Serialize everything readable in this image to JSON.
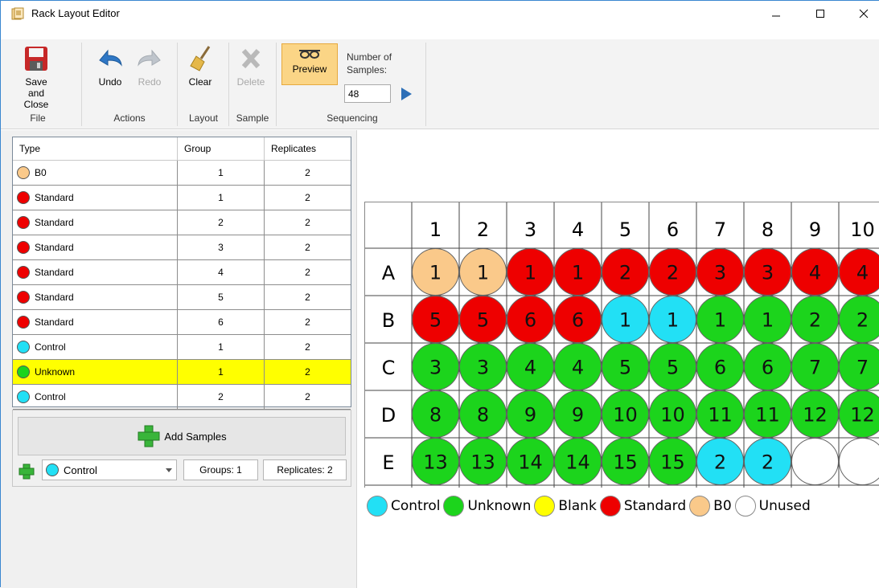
{
  "window": {
    "title": "Rack Layout Editor"
  },
  "ribbon": {
    "save_close": "Save and\nClose",
    "undo": "Undo",
    "redo": "Redo",
    "clear": "Clear",
    "delete": "Delete",
    "preview": "Preview",
    "number_of_samples_label": "Number of\nSamples:",
    "number_of_samples_value": "48",
    "groups": {
      "file": "File",
      "actions": "Actions",
      "layout": "Layout",
      "sample": "Sample",
      "sequencing": "Sequencing"
    }
  },
  "table": {
    "headers": {
      "type": "Type",
      "group": "Group",
      "replicates": "Replicates"
    },
    "rows": [
      {
        "type": "B0",
        "group": "1",
        "replicates": "2",
        "color": "#fac98a",
        "selected": false
      },
      {
        "type": "Standard",
        "group": "1",
        "replicates": "2",
        "color": "#ee0000",
        "selected": false
      },
      {
        "type": "Standard",
        "group": "2",
        "replicates": "2",
        "color": "#ee0000",
        "selected": false
      },
      {
        "type": "Standard",
        "group": "3",
        "replicates": "2",
        "color": "#ee0000",
        "selected": false
      },
      {
        "type": "Standard",
        "group": "4",
        "replicates": "2",
        "color": "#ee0000",
        "selected": false
      },
      {
        "type": "Standard",
        "group": "5",
        "replicates": "2",
        "color": "#ee0000",
        "selected": false
      },
      {
        "type": "Standard",
        "group": "6",
        "replicates": "2",
        "color": "#ee0000",
        "selected": false
      },
      {
        "type": "Control",
        "group": "1",
        "replicates": "2",
        "color": "#22e0f5",
        "selected": false
      },
      {
        "type": "Unknown",
        "group": "1",
        "replicates": "2",
        "color": "#1cd41c",
        "selected": true
      },
      {
        "type": "Control",
        "group": "2",
        "replicates": "2",
        "color": "#22e0f5",
        "selected": false
      }
    ]
  },
  "add_panel": {
    "add_button": "Add Samples",
    "selected_type": "Control",
    "selected_type_color": "#22e0f5",
    "groups_label": "Groups: 1",
    "replicates_label": "Replicates: 2"
  },
  "plate": {
    "columns": [
      "1",
      "2",
      "3",
      "4",
      "5",
      "6",
      "7",
      "8",
      "9",
      "10"
    ],
    "rows": [
      "A",
      "B",
      "C",
      "D",
      "E"
    ],
    "wells": [
      [
        [
          "1",
          "B0"
        ],
        [
          "1",
          "B0"
        ],
        [
          "1",
          "Standard"
        ],
        [
          "1",
          "Standard"
        ],
        [
          "2",
          "Standard"
        ],
        [
          "2",
          "Standard"
        ],
        [
          "3",
          "Standard"
        ],
        [
          "3",
          "Standard"
        ],
        [
          "4",
          "Standard"
        ],
        [
          "4",
          "Standard"
        ]
      ],
      [
        [
          "5",
          "Standard"
        ],
        [
          "5",
          "Standard"
        ],
        [
          "6",
          "Standard"
        ],
        [
          "6",
          "Standard"
        ],
        [
          "1",
          "Control"
        ],
        [
          "1",
          "Control"
        ],
        [
          "1",
          "Unknown"
        ],
        [
          "1",
          "Unknown"
        ],
        [
          "2",
          "Unknown"
        ],
        [
          "2",
          "Unknown"
        ]
      ],
      [
        [
          "3",
          "Unknown"
        ],
        [
          "3",
          "Unknown"
        ],
        [
          "4",
          "Unknown"
        ],
        [
          "4",
          "Unknown"
        ],
        [
          "5",
          "Unknown"
        ],
        [
          "5",
          "Unknown"
        ],
        [
          "6",
          "Unknown"
        ],
        [
          "6",
          "Unknown"
        ],
        [
          "7",
          "Unknown"
        ],
        [
          "7",
          "Unknown"
        ]
      ],
      [
        [
          "8",
          "Unknown"
        ],
        [
          "8",
          "Unknown"
        ],
        [
          "9",
          "Unknown"
        ],
        [
          "9",
          "Unknown"
        ],
        [
          "10",
          "Unknown"
        ],
        [
          "10",
          "Unknown"
        ],
        [
          "11",
          "Unknown"
        ],
        [
          "11",
          "Unknown"
        ],
        [
          "12",
          "Unknown"
        ],
        [
          "12",
          "Unknown"
        ]
      ],
      [
        [
          "13",
          "Unknown"
        ],
        [
          "13",
          "Unknown"
        ],
        [
          "14",
          "Unknown"
        ],
        [
          "14",
          "Unknown"
        ],
        [
          "15",
          "Unknown"
        ],
        [
          "15",
          "Unknown"
        ],
        [
          "2",
          "Control"
        ],
        [
          "2",
          "Control"
        ],
        [
          "",
          "Unused"
        ],
        [
          "",
          "Unused"
        ]
      ]
    ],
    "colors": {
      "Control": "#22e0f5",
      "Unknown": "#1cd41c",
      "Blank": "#ffff00",
      "Standard": "#ee0000",
      "B0": "#fac98a",
      "Unused": "#ffffff"
    }
  },
  "legend": [
    {
      "label": "Control",
      "color": "#22e0f5"
    },
    {
      "label": "Unknown",
      "color": "#1cd41c"
    },
    {
      "label": "Blank",
      "color": "#ffff00"
    },
    {
      "label": "Standard",
      "color": "#ee0000"
    },
    {
      "label": "B0",
      "color": "#fac98a"
    },
    {
      "label": "Unused",
      "color": "#ffffff"
    }
  ]
}
